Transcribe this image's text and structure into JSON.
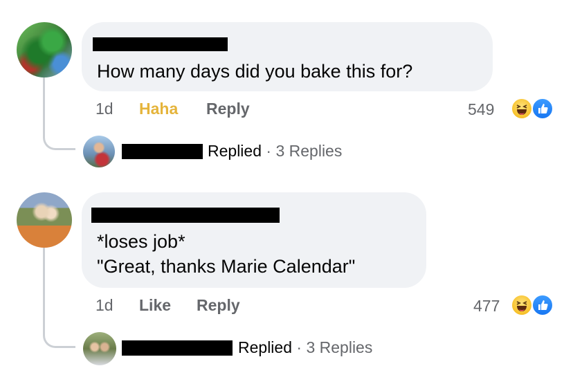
{
  "comments": [
    {
      "text": "How many days did you bake this for?",
      "timestamp": "1d",
      "reaction_action": "Haha",
      "reply_label": "Reply",
      "reaction_count": "549",
      "reply_summary": {
        "status": "Replied",
        "separator": "·",
        "count_text": "3 Replies"
      }
    },
    {
      "text_lines": [
        "*loses job*",
        "\"Great, thanks Marie Calendar\""
      ],
      "timestamp": "1d",
      "reaction_action": "Like",
      "reply_label": "Reply",
      "reaction_count": "477",
      "reply_summary": {
        "status": "Replied",
        "separator": "·",
        "count_text": "3 Replies"
      }
    }
  ],
  "icons": {
    "haha_reaction": "haha-emoji-icon",
    "like_reaction": "like-thumb-icon"
  },
  "colors": {
    "bubble": "#f0f2f5",
    "haha_active": "#e5b43b",
    "meta_gray": "#65676b",
    "like_blue": "#1877f2"
  }
}
